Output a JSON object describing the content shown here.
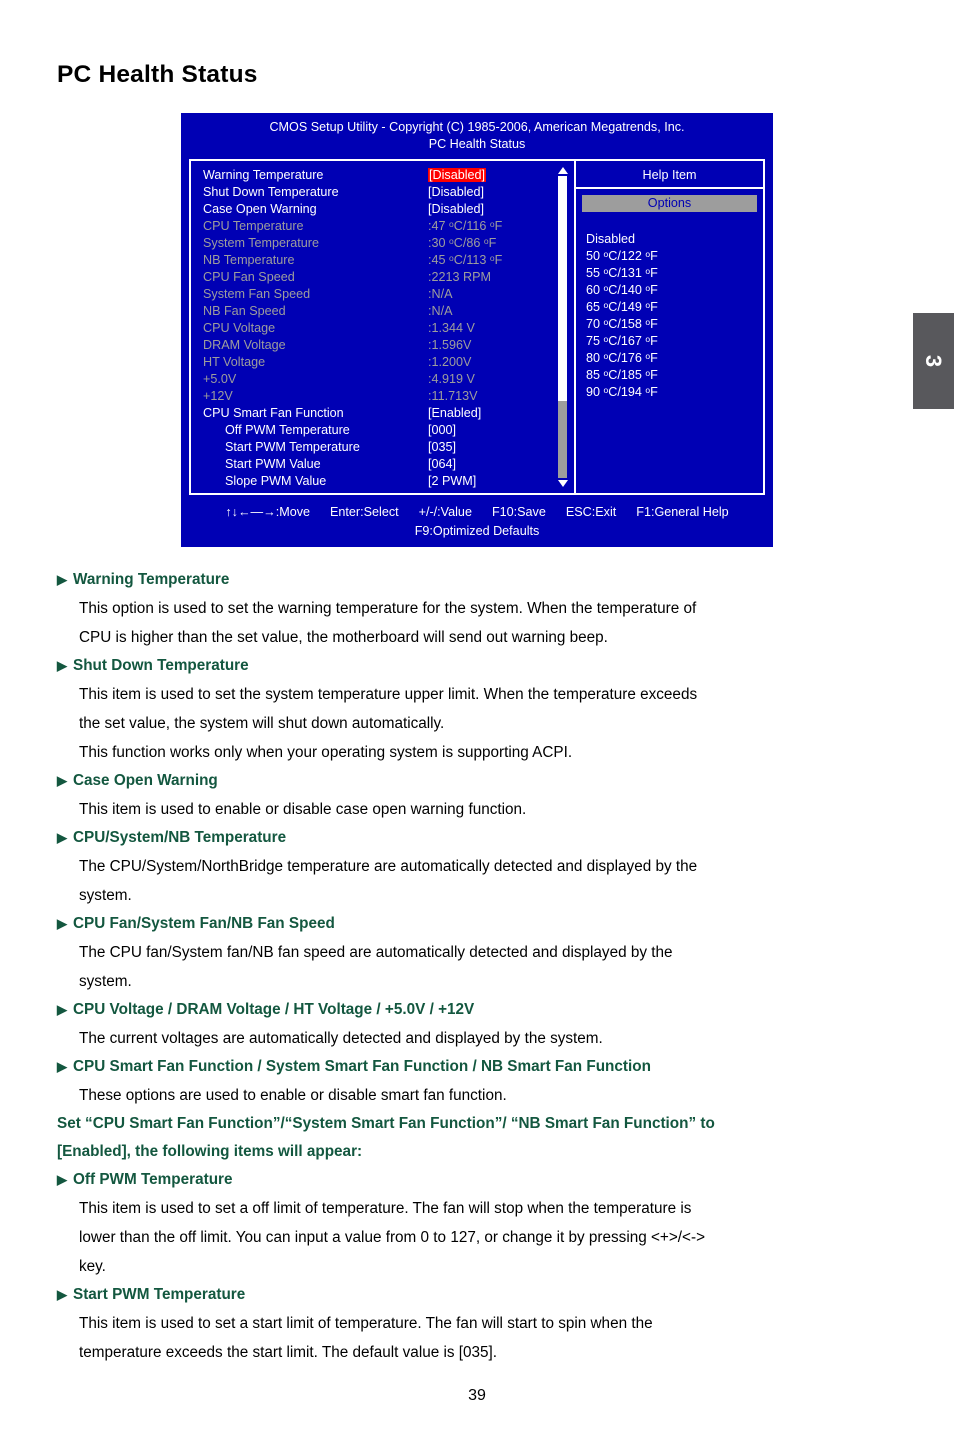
{
  "page": {
    "title": "PC Health Status",
    "number": "39",
    "chapter_tab": "3"
  },
  "bios": {
    "title_line1": "CMOS Setup Utility - Copyright (C) 1985-2006, American Megatrends, Inc.",
    "title_line2": "PC Health Status",
    "items": [
      {
        "label": "Warning Temperature",
        "value": "[Disabled]",
        "dim": false,
        "indent": false,
        "highlight": true
      },
      {
        "label": "Shut Down Temperature",
        "value": "[Disabled]",
        "dim": false,
        "indent": false,
        "highlight": false
      },
      {
        "label": "Case Open Warning",
        "value": "[Disabled]",
        "dim": false,
        "indent": false,
        "highlight": false
      },
      {
        "label": "CPU Temperature",
        "value": ":47 °C/116 °F",
        "dim": true,
        "indent": false,
        "highlight": false
      },
      {
        "label": "System Temperature",
        "value": ":30 °C/86 °F",
        "dim": true,
        "indent": false,
        "highlight": false
      },
      {
        "label": "NB Temperature",
        "value": ":45 °C/113 °F",
        "dim": true,
        "indent": false,
        "highlight": false
      },
      {
        "label": "CPU Fan Speed",
        "value": ":2213 RPM",
        "dim": true,
        "indent": false,
        "highlight": false
      },
      {
        "label": "System Fan Speed",
        "value": ":N/A",
        "dim": true,
        "indent": false,
        "highlight": false
      },
      {
        "label": "NB Fan Speed",
        "value": ":N/A",
        "dim": true,
        "indent": false,
        "highlight": false
      },
      {
        "label": "CPU  Voltage",
        "value": ":1.344 V",
        "dim": true,
        "indent": false,
        "highlight": false
      },
      {
        "label": "DRAM Voltage",
        "value": ":1.596V",
        "dim": true,
        "indent": false,
        "highlight": false
      },
      {
        "label": "HT Voltage",
        "value": ":1.200V",
        "dim": true,
        "indent": false,
        "highlight": false
      },
      {
        "label": "+5.0V",
        "value": ":4.919 V",
        "dim": true,
        "indent": false,
        "highlight": false
      },
      {
        "label": "+12V",
        "value": ":11.713V",
        "dim": true,
        "indent": false,
        "highlight": false
      },
      {
        "label": "CPU Smart Fan Function",
        "value": "[Enabled]",
        "dim": false,
        "indent": false,
        "highlight": false
      },
      {
        "label": "Off PWM Temperature",
        "value": "[000]",
        "dim": false,
        "indent": true,
        "highlight": false
      },
      {
        "label": "Start PWM Temperature",
        "value": "[035]",
        "dim": false,
        "indent": true,
        "highlight": false
      },
      {
        "label": "Start PWM Value",
        "value": "[064]",
        "dim": false,
        "indent": true,
        "highlight": false
      },
      {
        "label": "Slope PWM Value",
        "value": "[2 PWM]",
        "dim": false,
        "indent": true,
        "highlight": false
      }
    ],
    "help": {
      "header": "Help Item",
      "options_label": "Options",
      "options": [
        "Disabled",
        "50 °C/122 °F",
        "55 °C/131 °F",
        "60 °C/140 °F",
        "65 °C/149 °F",
        "70 °C/158 °F",
        "75 °C/167 °F",
        "80 °C/176 °F",
        "85 °C/185 °F",
        "90 °C/194 °F"
      ]
    },
    "footer": {
      "keys": [
        "↑↓←—→:Move",
        "Enter:Select",
        "+/-/:Value",
        "F10:Save",
        "ESC:Exit",
        "F1:General Help"
      ],
      "line2": "F9:Optimized Defaults"
    },
    "colors": {
      "background": "#0000b4",
      "highlight": "#fe0000",
      "dim_text": "#9d9d9d",
      "panel_border": "#ffffff"
    }
  },
  "doc": {
    "heading_color": "#13573f",
    "sections": [
      {
        "heading": "Warning Temperature",
        "paragraphs": [
          "This option is used to set the warning temperature for the system. When the temperature of",
          "CPU is higher than the set value, the motherboard will send out warning beep."
        ]
      },
      {
        "heading": "Shut Down Temperature",
        "paragraphs": [
          "This item is used to set the system temperature upper limit. When the temperature exceeds",
          "the set value, the system will shut down automatically.",
          "This function works only when your operating system is supporting ACPI."
        ]
      },
      {
        "heading": "Case Open Warning",
        "paragraphs": [
          "This item is used to enable or disable case open warning function."
        ]
      },
      {
        "heading": "CPU/System/NB Temperature",
        "paragraphs": [
          "The CPU/System/NorthBridge temperature are automatically detected and displayed by the",
          "system."
        ]
      },
      {
        "heading": "CPU Fan/System Fan/NB Fan Speed",
        "paragraphs": [
          "The CPU fan/System fan/NB fan speed are automatically detected and displayed by the",
          "system."
        ]
      },
      {
        "heading": "CPU Voltage / DRAM Voltage / HT Voltage / +5.0V / +12V",
        "paragraphs": [
          "The current voltages are automatically detected and displayed by the system."
        ]
      },
      {
        "heading": "CPU Smart Fan Function / System Smart Fan Function / NB Smart Fan Function",
        "paragraphs": [
          "These options are used to enable or disable smart fan function."
        ]
      }
    ],
    "note": [
      "Set “CPU Smart Fan Function”/“System Smart Fan Function”/ “NB Smart Fan Function” to",
      "[Enabled], the following items will appear:"
    ],
    "sections2": [
      {
        "heading": "Off PWM Temperature",
        "paragraphs": [
          "This item is used to set a off limit of temperature. The fan will stop when the temperature is",
          "lower than the off limit. You can input a value from 0 to 127, or change it by pressing <+>/<->",
          "key."
        ]
      },
      {
        "heading": "Start PWM Temperature",
        "paragraphs": [
          "This item is used to set a start limit of temperature. The fan will start to spin when the",
          "temperature exceeds the start limit. The default value is [035]."
        ]
      }
    ]
  }
}
